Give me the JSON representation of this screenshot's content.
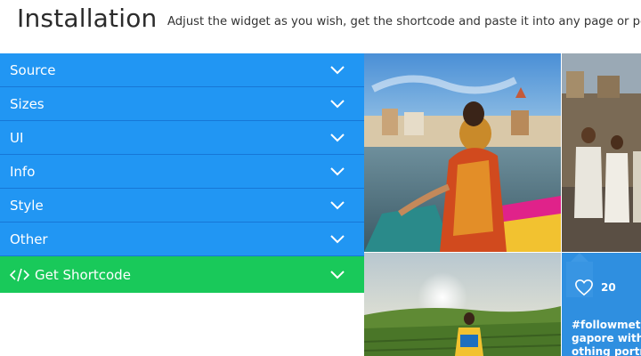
{
  "header": {
    "title": "Installation",
    "subtitle": "Adjust the widget as you wish, get the shortcode and paste it into any page or post."
  },
  "accordion": {
    "items": [
      {
        "label": "Source"
      },
      {
        "label": "Sizes"
      },
      {
        "label": "UI"
      },
      {
        "label": "Info"
      },
      {
        "label": "Style"
      },
      {
        "label": "Other"
      }
    ],
    "shortcode_label": "Get Shortcode"
  },
  "gallery": {
    "hover_tile": {
      "likes": "20",
      "caption_lines": [
        "#followmeto",
        "gapore with",
        "othing portr"
      ]
    }
  },
  "colors": {
    "accordion_blue": "#2196f3",
    "shortcode_green": "#19c95a",
    "overlay_blue": "#2f8fe0"
  }
}
